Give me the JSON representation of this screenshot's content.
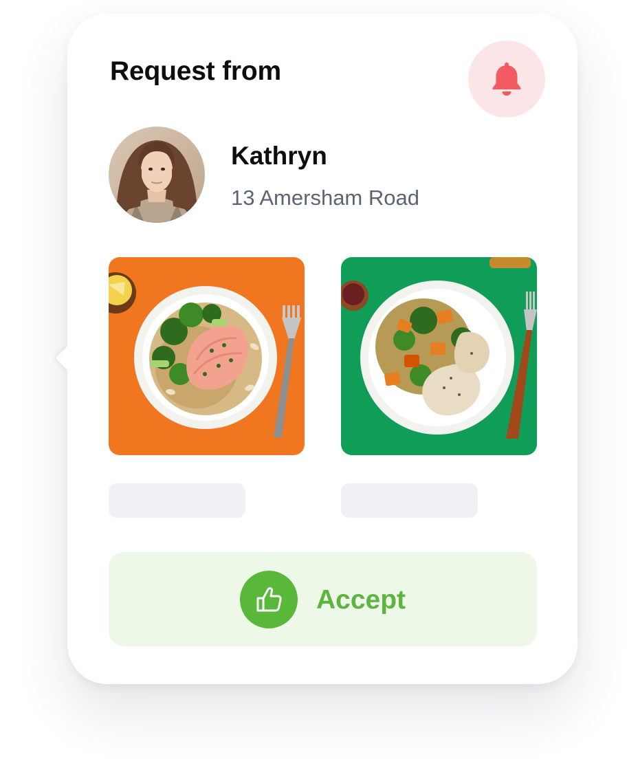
{
  "header": {
    "title": "Request from",
    "notification_icon": "bell-icon"
  },
  "requester": {
    "name": "Kathryn",
    "address": "13 Amersham Road",
    "avatar": "avatar-photo"
  },
  "meals": [
    {
      "image": "salmon-broccoli-plate",
      "background": "#f07720"
    },
    {
      "image": "chicken-sweet-potato-plate",
      "background": "#0f9d58"
    }
  ],
  "actions": {
    "accept_label": "Accept",
    "accept_icon": "thumbs-up-icon"
  },
  "colors": {
    "accent_green": "#59b83a",
    "accent_green_bg": "#eef8e9",
    "bell_red": "#f25b5f",
    "bell_bg": "#fbe5e6"
  }
}
